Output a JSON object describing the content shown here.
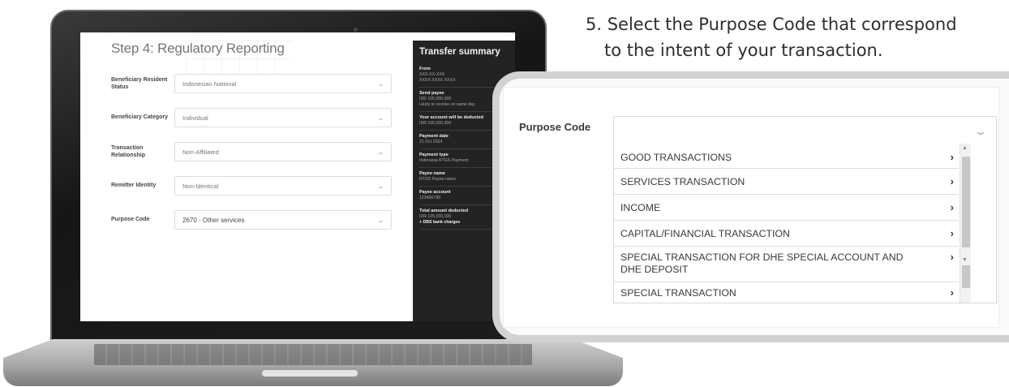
{
  "laptop_screen": {
    "step_title": "Step 4: Regulatory Reporting",
    "form_rows": [
      {
        "label": "Beneficiary Resident Status",
        "value": "Indonesian National"
      },
      {
        "label": "Beneficiary Category",
        "value": "Individual"
      },
      {
        "label": "Transaction Relationship",
        "value": "Non-Affiliated"
      },
      {
        "label": "Remitter Identity",
        "value": "Non-Identical"
      },
      {
        "label": "Purpose Code",
        "value": "2670 - Other services"
      }
    ],
    "summary": {
      "title": "Transfer summary",
      "items": [
        {
          "label": "From",
          "lines": [
            "XXX-XX-XXX",
            "XXXX XXXX XXXX"
          ]
        },
        {
          "label": "Send payee",
          "lines": [
            "IDR 105,000,000",
            "Likely to receive on same day"
          ]
        },
        {
          "label": "Your account will be deducted",
          "lines": [
            "IDR 105,000,000"
          ]
        },
        {
          "label": "Payment date",
          "lines": [
            "21 Oct 2024"
          ]
        },
        {
          "label": "Payment type",
          "lines": [
            "Indonesia RTGS Payment"
          ]
        },
        {
          "label": "Payee name",
          "lines": [
            "RTGS Payee name"
          ]
        },
        {
          "label": "Payee account",
          "lines": [
            "123456789"
          ]
        },
        {
          "label": "Total amount deducted",
          "lines": [
            "IDR 105,000,000",
            "+ DBS bank charges"
          ]
        }
      ]
    }
  },
  "instruction": {
    "line1": "5. Select the Purpose Code that correspond",
    "line2": "to the intent of your transaction."
  },
  "purpose_code": {
    "label": "Purpose Code",
    "selected": "",
    "options": [
      {
        "label": "GOOD TRANSACTIONS"
      },
      {
        "label": "SERVICES TRANSACTION"
      },
      {
        "label": "INCOME"
      },
      {
        "label": "CAPITAL/FINANCIAL TRANSACTION"
      },
      {
        "label": "SPECIAL TRANSACTION FOR DHE SPECIAL ACCOUNT AND DHE DEPOSIT"
      },
      {
        "label": "SPECIAL TRANSACTION"
      }
    ]
  }
}
